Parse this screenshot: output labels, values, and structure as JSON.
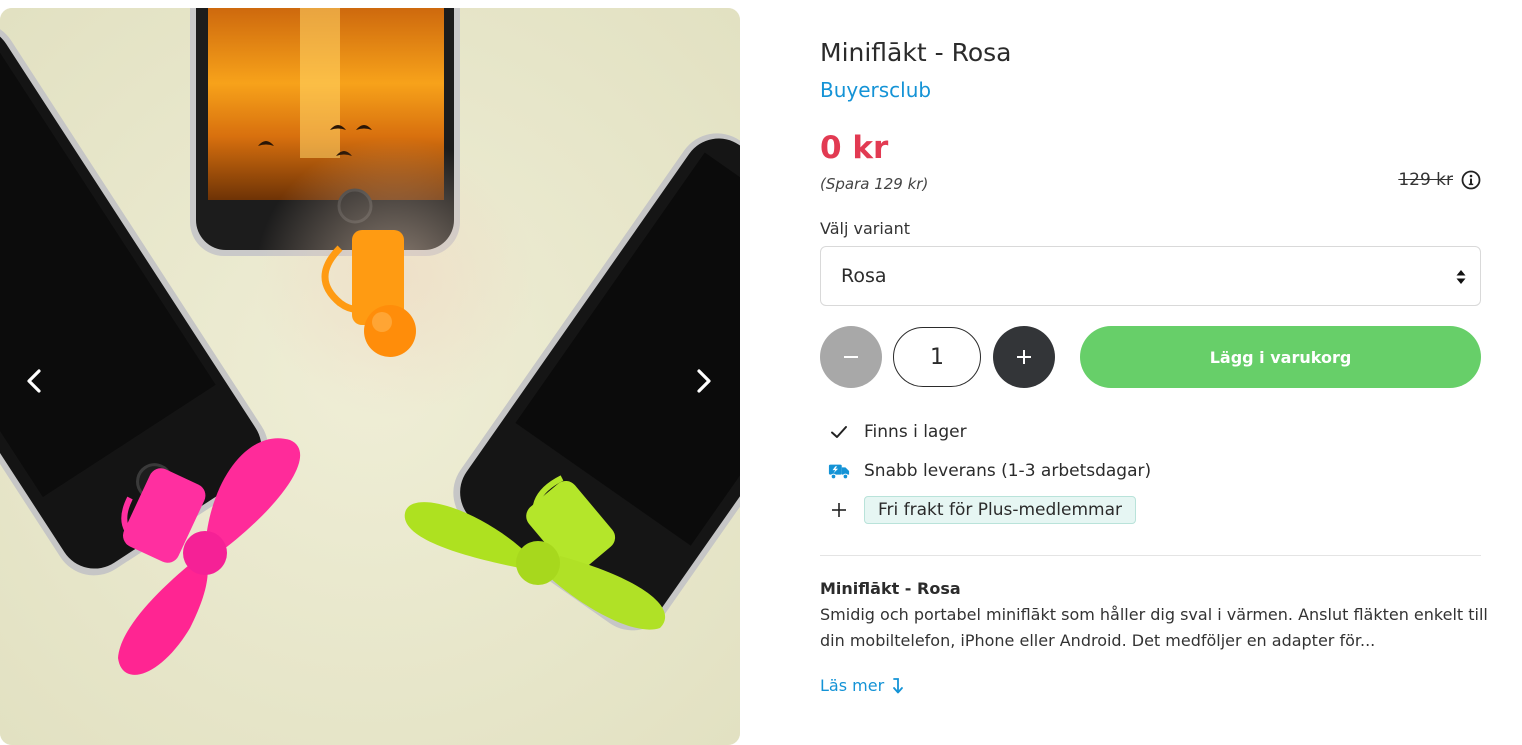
{
  "product": {
    "title": "Miniflākt - Rosa",
    "brand": "Buyersclub",
    "price": "0 kr",
    "savings": "(Spara 129 kr)",
    "original_price": "129 kr"
  },
  "variant": {
    "label": "Välj variant",
    "selected": "Rosa"
  },
  "quantity": {
    "value": "1",
    "minus_symbol": "−",
    "plus_symbol": "+"
  },
  "cart": {
    "add_label": "Lägg i varukorg"
  },
  "usps": [
    {
      "icon": "check-icon",
      "text": "Finns i lager"
    },
    {
      "icon": "delivery-truck-icon",
      "text": "Snabb leverans (1-3 arbetsdagar)"
    },
    {
      "icon": "plus-icon",
      "text": "Fri frakt för Plus-medlemmar"
    }
  ],
  "description": {
    "title": "Miniflākt - Rosa",
    "text": "Smidig och portabel miniflākt som håller dig sval i värmen. Anslut fläkten enkelt till din mobiltelefon, iPhone eller Android. Det medföljer en adapter för...",
    "read_more": "Läs mer"
  },
  "colors": {
    "price": "#e23a52",
    "brand_link": "#1493d6",
    "add_to_cart": "#67cf69",
    "qty_plus": "#333538",
    "qty_minus": "#a8a8a8",
    "photo_background": "#e9e8cc"
  },
  "icons": {
    "prev": "chevron-left-icon",
    "next": "chevron-right-icon",
    "info": "info-icon",
    "select": "sort-arrows-icon",
    "read_more": "arrow-down-icon"
  }
}
